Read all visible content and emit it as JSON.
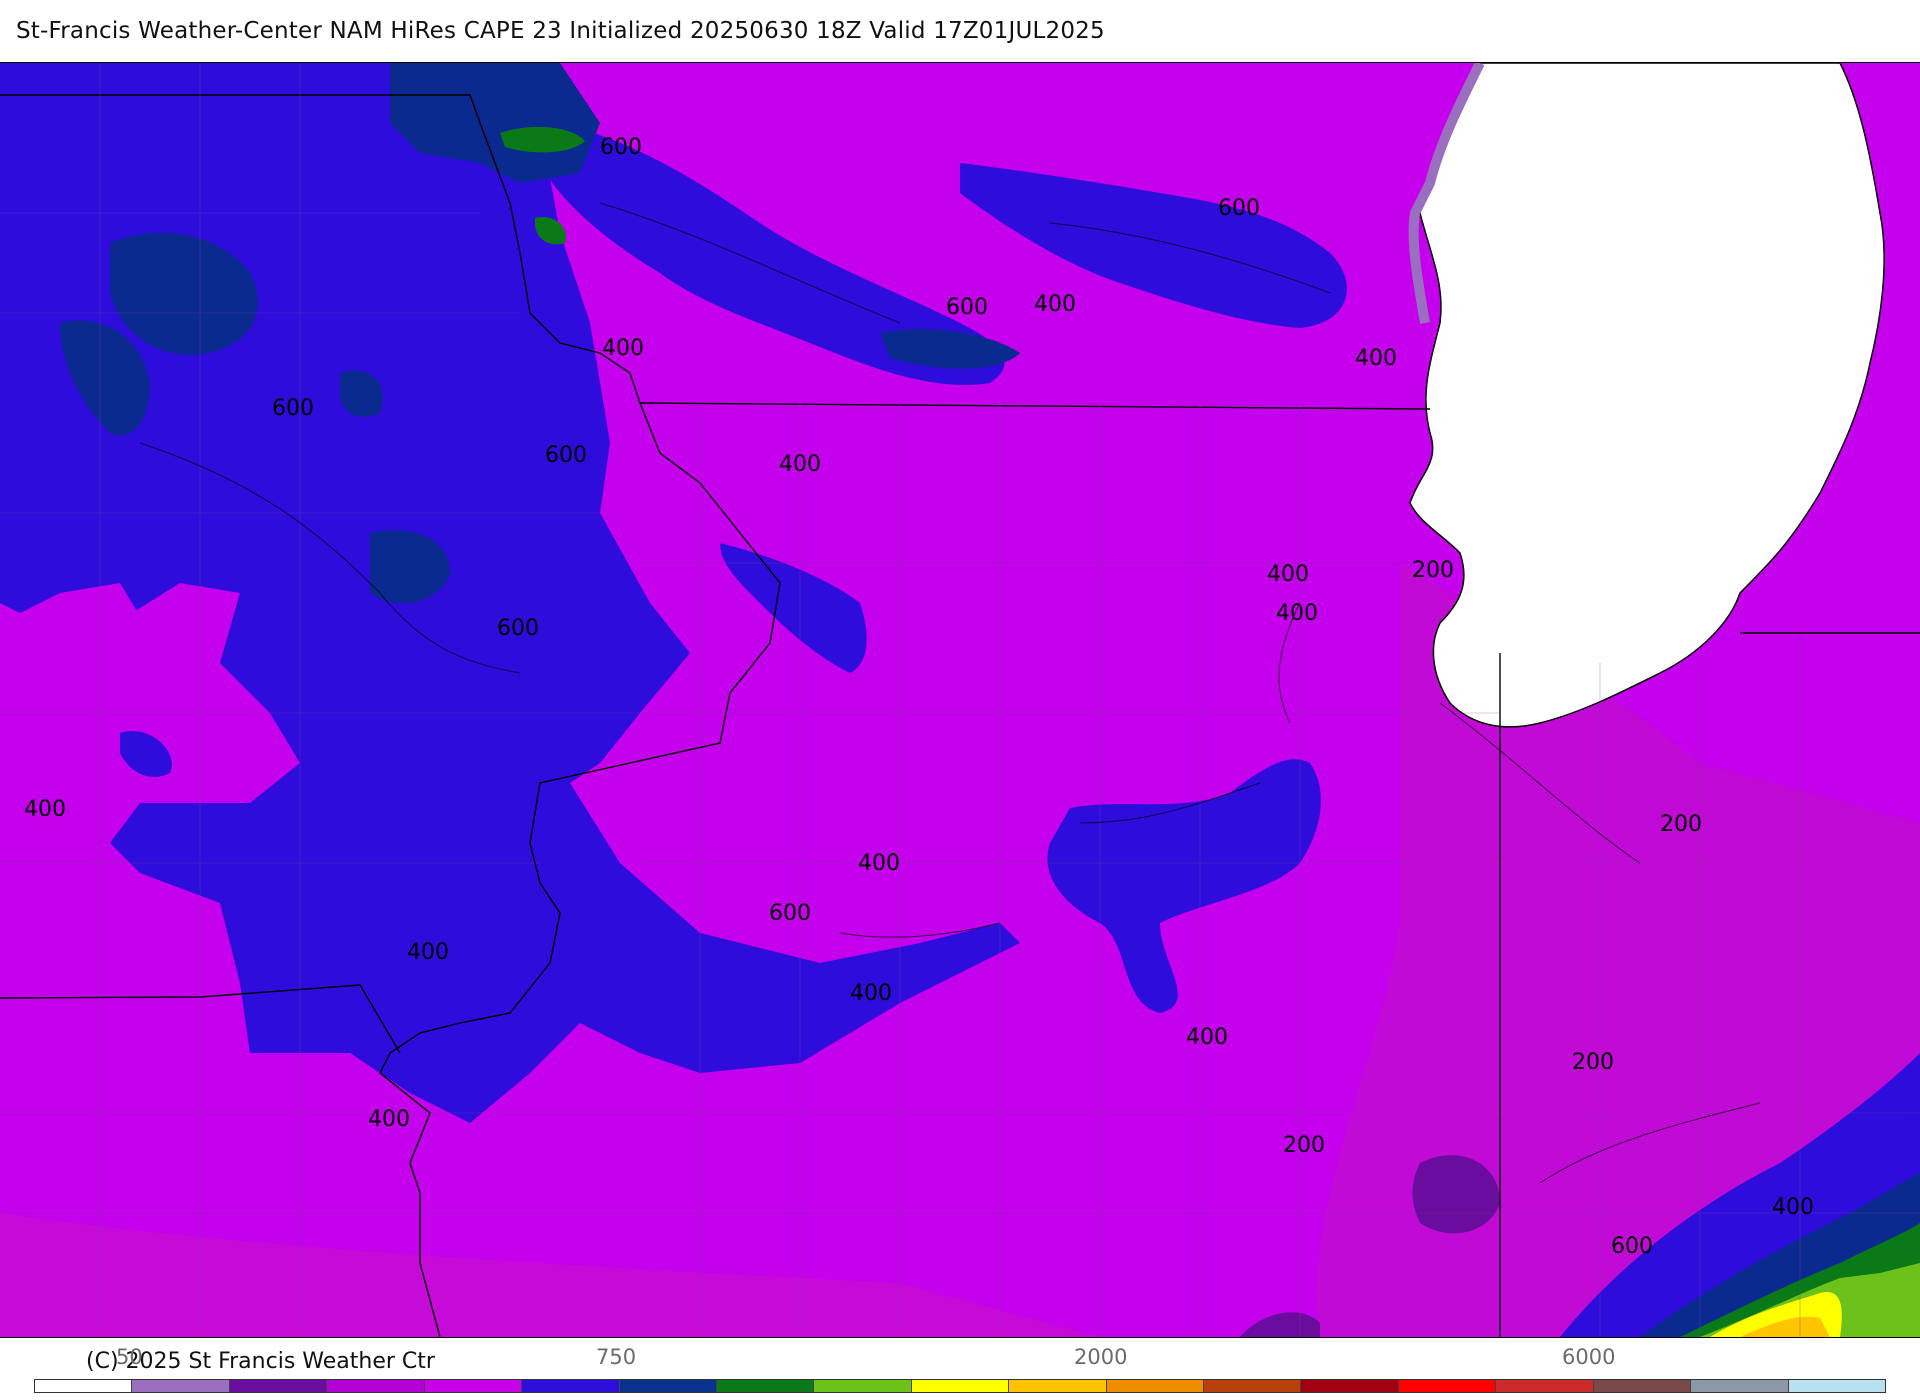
{
  "header": {
    "title": "St-Francis Weather-Center NAM HiRes CAPE  23 Initialized 20250630 18Z Valid 17Z01JUL2025"
  },
  "map": {
    "contour_labels": [
      "600",
      "600",
      "600",
      "400",
      "600",
      "400",
      "600",
      "400",
      "400",
      "400",
      "600",
      "400",
      "400",
      "200",
      "400",
      "600",
      "400",
      "400",
      "200",
      "400",
      "200",
      "200",
      "400",
      "600",
      "400"
    ]
  },
  "footer": {
    "copyright": "(C) 2025 St Francis Weather Ctr"
  },
  "colorbar": {
    "tick_labels": [
      "50",
      "750",
      "2000",
      "6000"
    ],
    "colors": [
      "#ffffff",
      "#9b6fc0",
      "#6a0d9e",
      "#b300d4",
      "#c700e8",
      "#2a10d8",
      "#08328c",
      "#0a7a18",
      "#6cc21a",
      "#ffff00",
      "#ffc400",
      "#f08c00",
      "#b8400a",
      "#a00010",
      "#ff0000",
      "#cc2a2a",
      "#7a4a4a",
      "#8c98a8",
      "#b8e0ee"
    ]
  },
  "colors": {
    "base_cape": "#c400ec",
    "low_cape": "#2e0cdc",
    "lake": "#ffffff"
  }
}
